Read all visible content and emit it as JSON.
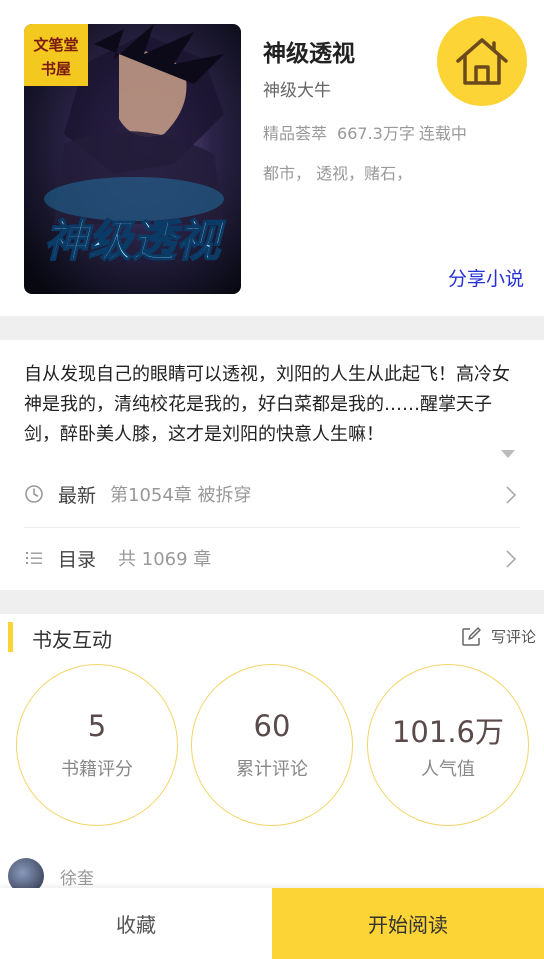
{
  "book": {
    "cover_logo_line1": "文笔堂",
    "cover_logo_line2": "书屋",
    "cover_title": "神级透视",
    "title": "神级透视",
    "author": "神级大牛",
    "category": "精品荟萃",
    "word_count": "667.3万字",
    "status": "连载中",
    "tags": "都市， 透视，赌石，",
    "share_label": "分享小说"
  },
  "home_icon": "home-icon",
  "intro": {
    "text": "自从发现自己的眼睛可以透视，刘阳的人生从此起飞！高冷女神是我的，清纯校花是我的，好白菜都是我的……醒掌天子剑，醉卧美人膝，这才是刘阳的快意人生嘛！",
    "expand_icon": "caret-down-icon"
  },
  "latest": {
    "label": "最新",
    "value": "第1054章 被拆穿",
    "icon": "clock-icon"
  },
  "catalog": {
    "label": "目录",
    "value": "共 1069 章",
    "icon": "list-icon"
  },
  "interaction": {
    "title": "书友互动",
    "write_review": "写评论",
    "write_icon": "edit-icon",
    "stats": [
      {
        "value": "5",
        "label": "书籍评分"
      },
      {
        "value": "60",
        "label": "累计评论"
      },
      {
        "value": "101.6万",
        "label": "人气值"
      }
    ]
  },
  "comment": {
    "user": "徐奎"
  },
  "actions": {
    "favorite": "收藏",
    "read": "开始阅读"
  },
  "colors": {
    "accent": "#fcd436",
    "link": "#2430d6",
    "gap": "#efefef"
  }
}
